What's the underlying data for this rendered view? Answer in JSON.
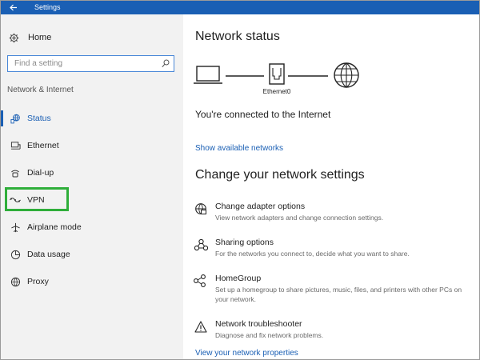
{
  "window": {
    "title": "Settings",
    "back_icon": "back-arrow-icon"
  },
  "sidebar": {
    "home_label": "Home",
    "search_placeholder": "Find a setting",
    "section_label": "Network & Internet",
    "items": [
      {
        "label": "Status",
        "icon": "status-globe-icon",
        "active": true
      },
      {
        "label": "Ethernet",
        "icon": "ethernet-icon"
      },
      {
        "label": "Dial-up",
        "icon": "dial-up-icon"
      },
      {
        "label": "VPN",
        "icon": "vpn-icon",
        "highlighted": true
      },
      {
        "label": "Airplane mode",
        "icon": "airplane-icon"
      },
      {
        "label": "Data usage",
        "icon": "data-usage-icon"
      },
      {
        "label": "Proxy",
        "icon": "proxy-globe-icon"
      }
    ]
  },
  "main": {
    "heading": "Network status",
    "diagram": {
      "device_label": "Ethernet0"
    },
    "status_text": "You're connected to the Internet",
    "show_networks_link": "Show available networks",
    "settings_heading": "Change your network settings",
    "options": [
      {
        "title": "Change adapter options",
        "desc": "View network adapters and change connection settings.",
        "icon": "adapter-globe-icon"
      },
      {
        "title": "Sharing options",
        "desc": "For the networks you connect to, decide what you want to share.",
        "icon": "sharing-icon"
      },
      {
        "title": "HomeGroup",
        "desc": "Set up a homegroup to share pictures, music, files, and printers with other PCs on your network.",
        "icon": "homegroup-icon"
      },
      {
        "title": "Network troubleshooter",
        "desc": "Diagnose and fix network problems.",
        "icon": "warning-icon"
      }
    ],
    "properties_link": "View your network properties"
  },
  "colors": {
    "accent": "#1a5fb4",
    "highlight": "#2fae3a",
    "sidebar_bg": "#f2f2f2"
  }
}
